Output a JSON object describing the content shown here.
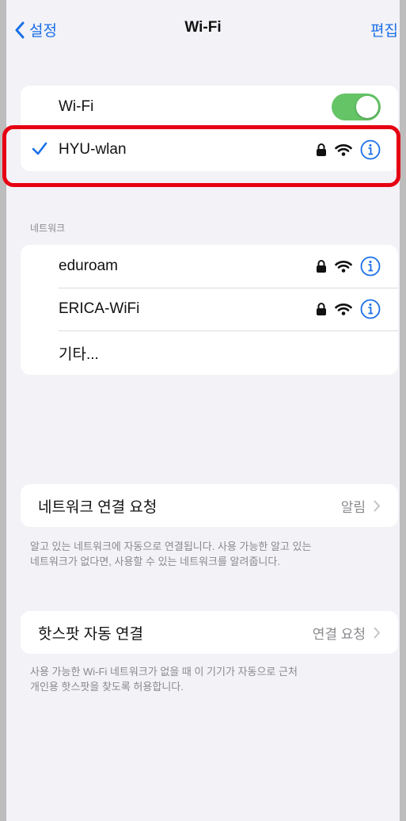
{
  "nav": {
    "back_label": "설정",
    "title": "Wi-Fi",
    "edit_label": "편집"
  },
  "wifi": {
    "label": "Wi-Fi",
    "enabled": true,
    "connected_network": "HYU-wlan"
  },
  "networks": {
    "section_title": "네트워크",
    "items": [
      {
        "name": "eduroam",
        "secured": true
      },
      {
        "name": "ERICA-WiFi",
        "secured": true
      }
    ],
    "other_label": "기타..."
  },
  "ask_to_join": {
    "label": "네트워크 연결 요청",
    "value": "알림",
    "footer_line1": "알고 있는 네트워크에 자동으로 연결됩니다. 사용 가능한 알고 있는",
    "footer_line2": "네트워크가 없다면, 사용할 수 있는 네트워크를 알려줍니다."
  },
  "hotspot": {
    "label": "핫스팟 자동 연결",
    "value": "연결 요청",
    "footer_line1": "사용 가능한 Wi-Fi 네트워크가 없을 때 이 기기가 자동으로 근처",
    "footer_line2": "개인용 핫스팟을 찾도록 허용합니다."
  },
  "colors": {
    "accent": "#1a6fe8",
    "toggle_on": "#65c466",
    "highlight": "#e60012"
  }
}
